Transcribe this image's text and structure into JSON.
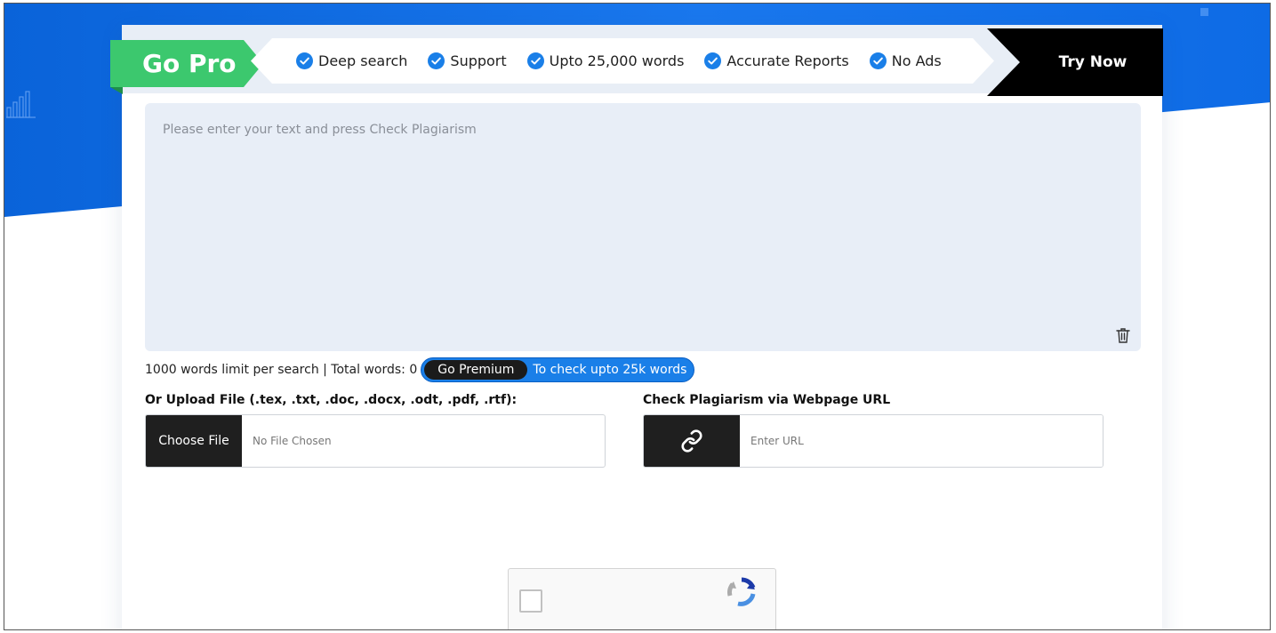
{
  "promo": {
    "title": "Go Pro",
    "features": [
      {
        "label": "Deep search"
      },
      {
        "label": "Support"
      },
      {
        "label": "Upto 25,000 words"
      },
      {
        "label": "Accurate Reports"
      },
      {
        "label": "No Ads"
      }
    ],
    "cta": "Try Now"
  },
  "editor": {
    "placeholder": "Please enter your text and press Check Plagiarism"
  },
  "word_info": {
    "text": "1000 words limit per search | Total words: 0",
    "premium_button": "Go Premium",
    "premium_text": "To check upto 25k words"
  },
  "upload": {
    "label": "Or Upload File (.tex, .txt, .doc, .docx, .odt, .pdf, .rtf):",
    "button": "Choose File",
    "status": "No File Chosen"
  },
  "url": {
    "label": "Check Plagiarism via Webpage URL",
    "placeholder": "Enter URL"
  },
  "icons": {
    "feature": "check-circle-icon",
    "clear": "trash-icon",
    "url": "link-icon",
    "captcha": "recaptcha-icon"
  },
  "colors": {
    "brand_blue": "#1a78ee",
    "go_pro_green": "#3cc86e",
    "cta_black": "#000000",
    "check_blue": "#1a7fe8"
  }
}
